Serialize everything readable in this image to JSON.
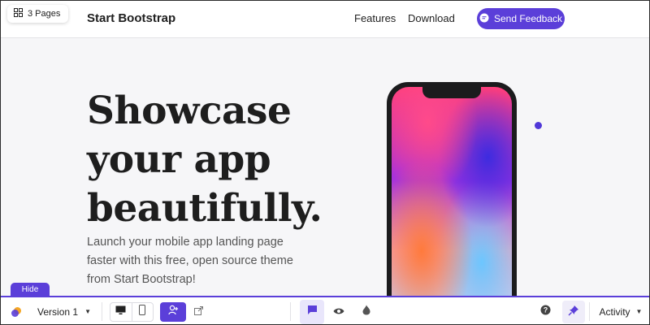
{
  "pages_pill": {
    "label": "3 Pages",
    "icon": "grid-icon"
  },
  "navbar": {
    "brand": "Start Bootstrap",
    "links": [
      "Features",
      "Download"
    ],
    "feedback_button": {
      "label": "Send Feedback",
      "icon": "chat-bubble-icon"
    }
  },
  "hero": {
    "title": "Showcase your app beautifully.",
    "subtitle": "Launch your mobile app landing page faster with this free, open source theme from Start Bootstrap!"
  },
  "toolbar": {
    "hide_label": "Hide",
    "version_label": "Version 1",
    "activity_label": "Activity"
  },
  "colors": {
    "accent": "#5b3fd9",
    "comment_active_bg": "#e9e6fb",
    "text_dark": "#1e1e1e"
  }
}
